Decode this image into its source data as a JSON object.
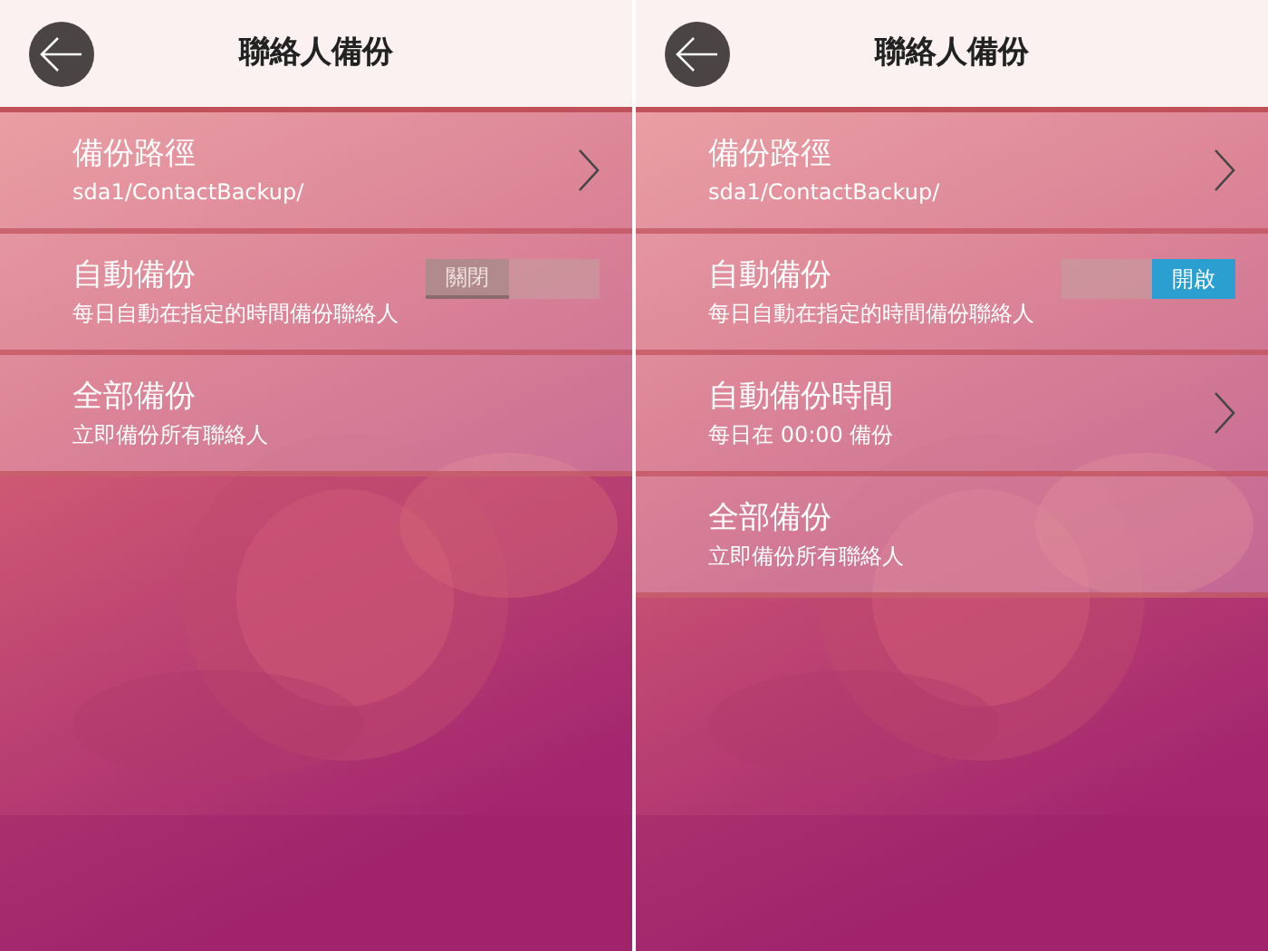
{
  "screens": [
    {
      "title": "聯絡人備份",
      "items": [
        {
          "kind": "link",
          "title": "備份路徑",
          "subtitle": "sda1/ContactBackup/"
        },
        {
          "kind": "toggle",
          "title": "自動備份",
          "subtitle": "每日自動在指定的時間備份聯絡人",
          "on": false,
          "toggle_label": "關閉"
        },
        {
          "kind": "action",
          "title": "全部備份",
          "subtitle": "立即備份所有聯絡人"
        }
      ]
    },
    {
      "title": "聯絡人備份",
      "items": [
        {
          "kind": "link",
          "title": "備份路徑",
          "subtitle": "sda1/ContactBackup/"
        },
        {
          "kind": "toggle",
          "title": "自動備份",
          "subtitle": "每日自動在指定的時間備份聯絡人",
          "on": true,
          "toggle_label": "開啟"
        },
        {
          "kind": "link",
          "title": "自動備份時間",
          "subtitle": "每日在 00:00 備份"
        },
        {
          "kind": "action",
          "title": "全部備份",
          "subtitle": "立即備份所有聯絡人"
        }
      ]
    }
  ]
}
